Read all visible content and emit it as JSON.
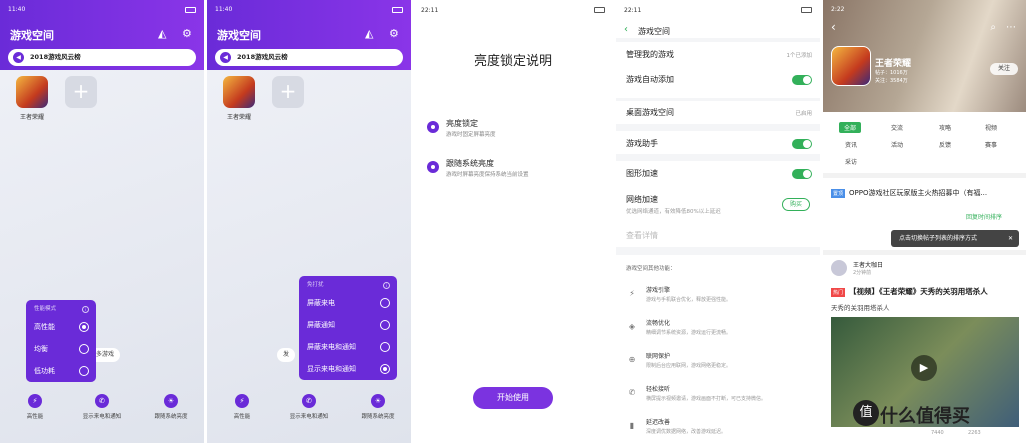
{
  "colors": {
    "purple": "#6a2bd8",
    "green": "#33b05a"
  },
  "s1": {
    "time": "11:40",
    "title": "游戏空间",
    "banner": "2018游戏风云榜",
    "game_label": "王者荣耀",
    "popup_head": "性能模式",
    "modes": [
      "高性能",
      "均衡",
      "低功耗"
    ],
    "more_games": "更多游戏",
    "bottom": [
      "高性能",
      "显示来电和通知",
      "跟随系统亮度"
    ]
  },
  "s2": {
    "time": "11:40",
    "title": "游戏空间",
    "banner": "2018游戏风云榜",
    "game_label": "王者荣耀",
    "popup_head": "免打扰",
    "options": [
      "屏蔽来电",
      "屏蔽通知",
      "屏蔽来电和通知",
      "显示来电和通知"
    ],
    "partial_left": "发",
    "bottom": [
      "高性能",
      "显示来电和通知",
      "跟随系统亮度"
    ]
  },
  "s3": {
    "time": "22:11",
    "title": "亮度锁定说明",
    "opt1_title": "亮度锁定",
    "opt1_desc": "游戏时固定屏幕亮度",
    "opt2_title": "跟随系统亮度",
    "opt2_desc": "游戏时屏幕亮度保持系统当前设置",
    "start": "开始使用"
  },
  "s4": {
    "time": "22:11",
    "title": "游戏空间",
    "manage": "管理我的游戏",
    "manage_val": "1个已添加",
    "auto_add": "游戏自动添加",
    "desktop": "桌面游戏空间",
    "desktop_val": "已启用",
    "assistant": "游戏助手",
    "gpu": "图形加速",
    "net": "网络加速",
    "net_desc": "优选网络通道，有效降低80%以上延迟",
    "buy": "购买",
    "details": "查看详情",
    "other_head": "游戏空间其他功能：",
    "features": [
      {
        "t": "游戏引擎",
        "d": "游戏与手机联合优化，释放更强性能。"
      },
      {
        "t": "流畅优化",
        "d": "精细调节系统资源，游戏运行更流畅。"
      },
      {
        "t": "联网保护",
        "d": "限制后台应用联网，游戏网络更稳定。"
      },
      {
        "t": "轻松接听",
        "d": "横屏提示视频邀请，游戏画面不打断，可已支持微信。"
      },
      {
        "t": "延迟改善",
        "d": "深度调优数据网络，改善游戏延迟。"
      }
    ]
  },
  "s5": {
    "time": "2:22",
    "game": "王者荣耀",
    "stat1": "帖子：1016万",
    "stat2": "关注：3584万",
    "follow": "关注",
    "tabs": [
      "全部",
      "交流",
      "攻略",
      "视频",
      "资讯",
      "活动",
      "反馈",
      "赛事",
      "采访"
    ],
    "pinned_tag": "置顶",
    "pinned": "OPPO游戏社区玩家版主火热招募中（有福...",
    "sort": "回复时间排序",
    "tooltip": "点击切换帖子列表的排序方式",
    "user": "王者大咖日",
    "user_time": "2分钟前",
    "post_tag": "热门",
    "post_title": "【视频】《王者荣耀》天秀的关羽用塔杀人",
    "post_sub": "天秀的关羽用塔杀人",
    "views": "7440",
    "likes": "2263"
  },
  "watermark": "什么值得买"
}
